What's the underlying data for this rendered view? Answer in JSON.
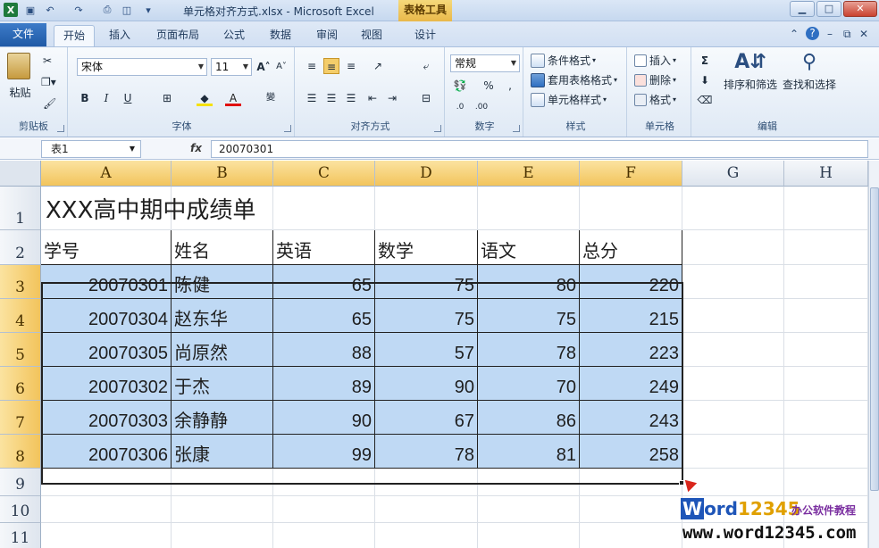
{
  "titlebar": {
    "document_title": "单元格对齐方式.xlsx - Microsoft Excel",
    "context_tool": "表格工具",
    "app_icon": "X"
  },
  "tabs": [
    "文件",
    "开始",
    "插入",
    "页面布局",
    "公式",
    "数据",
    "审阅",
    "视图",
    "设计"
  ],
  "ribbon": {
    "clipboard": {
      "paste": "粘贴",
      "label": "剪贴板"
    },
    "font": {
      "name": "宋体",
      "size": "11",
      "bold": "B",
      "italic": "I",
      "underline": "U",
      "label": "字体"
    },
    "alignment": {
      "label": "对齐方式"
    },
    "number": {
      "format": "常规",
      "label": "数字"
    },
    "styles": {
      "conditional": "条件格式",
      "table_format": "套用表格格式",
      "cell_styles": "单元格样式",
      "label": "样式"
    },
    "cells": {
      "insert": "插入",
      "delete": "删除",
      "format": "格式",
      "label": "单元格"
    },
    "editing": {
      "sort_filter": "排序和筛选",
      "find_select": "查找和选择",
      "label": "编辑"
    }
  },
  "formula_bar": {
    "name_box": "表1",
    "fx": "fx",
    "value": "20070301"
  },
  "grid": {
    "columns": [
      "A",
      "B",
      "C",
      "D",
      "E",
      "F",
      "G",
      "H"
    ],
    "rows": [
      "1",
      "2",
      "3",
      "4",
      "5",
      "6",
      "7",
      "8",
      "9",
      "10",
      "11"
    ],
    "title": "XXX高中期中成绩单",
    "headers": [
      "学号",
      "姓名",
      "英语",
      "数学",
      "语文",
      "总分"
    ],
    "records": [
      [
        "20070301",
        "陈健",
        "65",
        "75",
        "80",
        "220"
      ],
      [
        "20070304",
        "赵东华",
        "65",
        "75",
        "75",
        "215"
      ],
      [
        "20070305",
        "尚原然",
        "88",
        "57",
        "78",
        "223"
      ],
      [
        "20070302",
        "于杰",
        "89",
        "90",
        "70",
        "249"
      ],
      [
        "20070303",
        "余静静",
        "90",
        "67",
        "86",
        "243"
      ],
      [
        "20070306",
        "张康",
        "99",
        "78",
        "81",
        "258"
      ]
    ]
  },
  "watermark": {
    "logo_w": "W",
    "logo_rest": "ord",
    "logo_num": "12345",
    "tagline": "办公软件教程",
    "url": "www.word12345.com"
  },
  "colors": {
    "selection": "#bfd9f4",
    "header_selected": "#f2c45c",
    "accent": "#1f5aa6"
  }
}
